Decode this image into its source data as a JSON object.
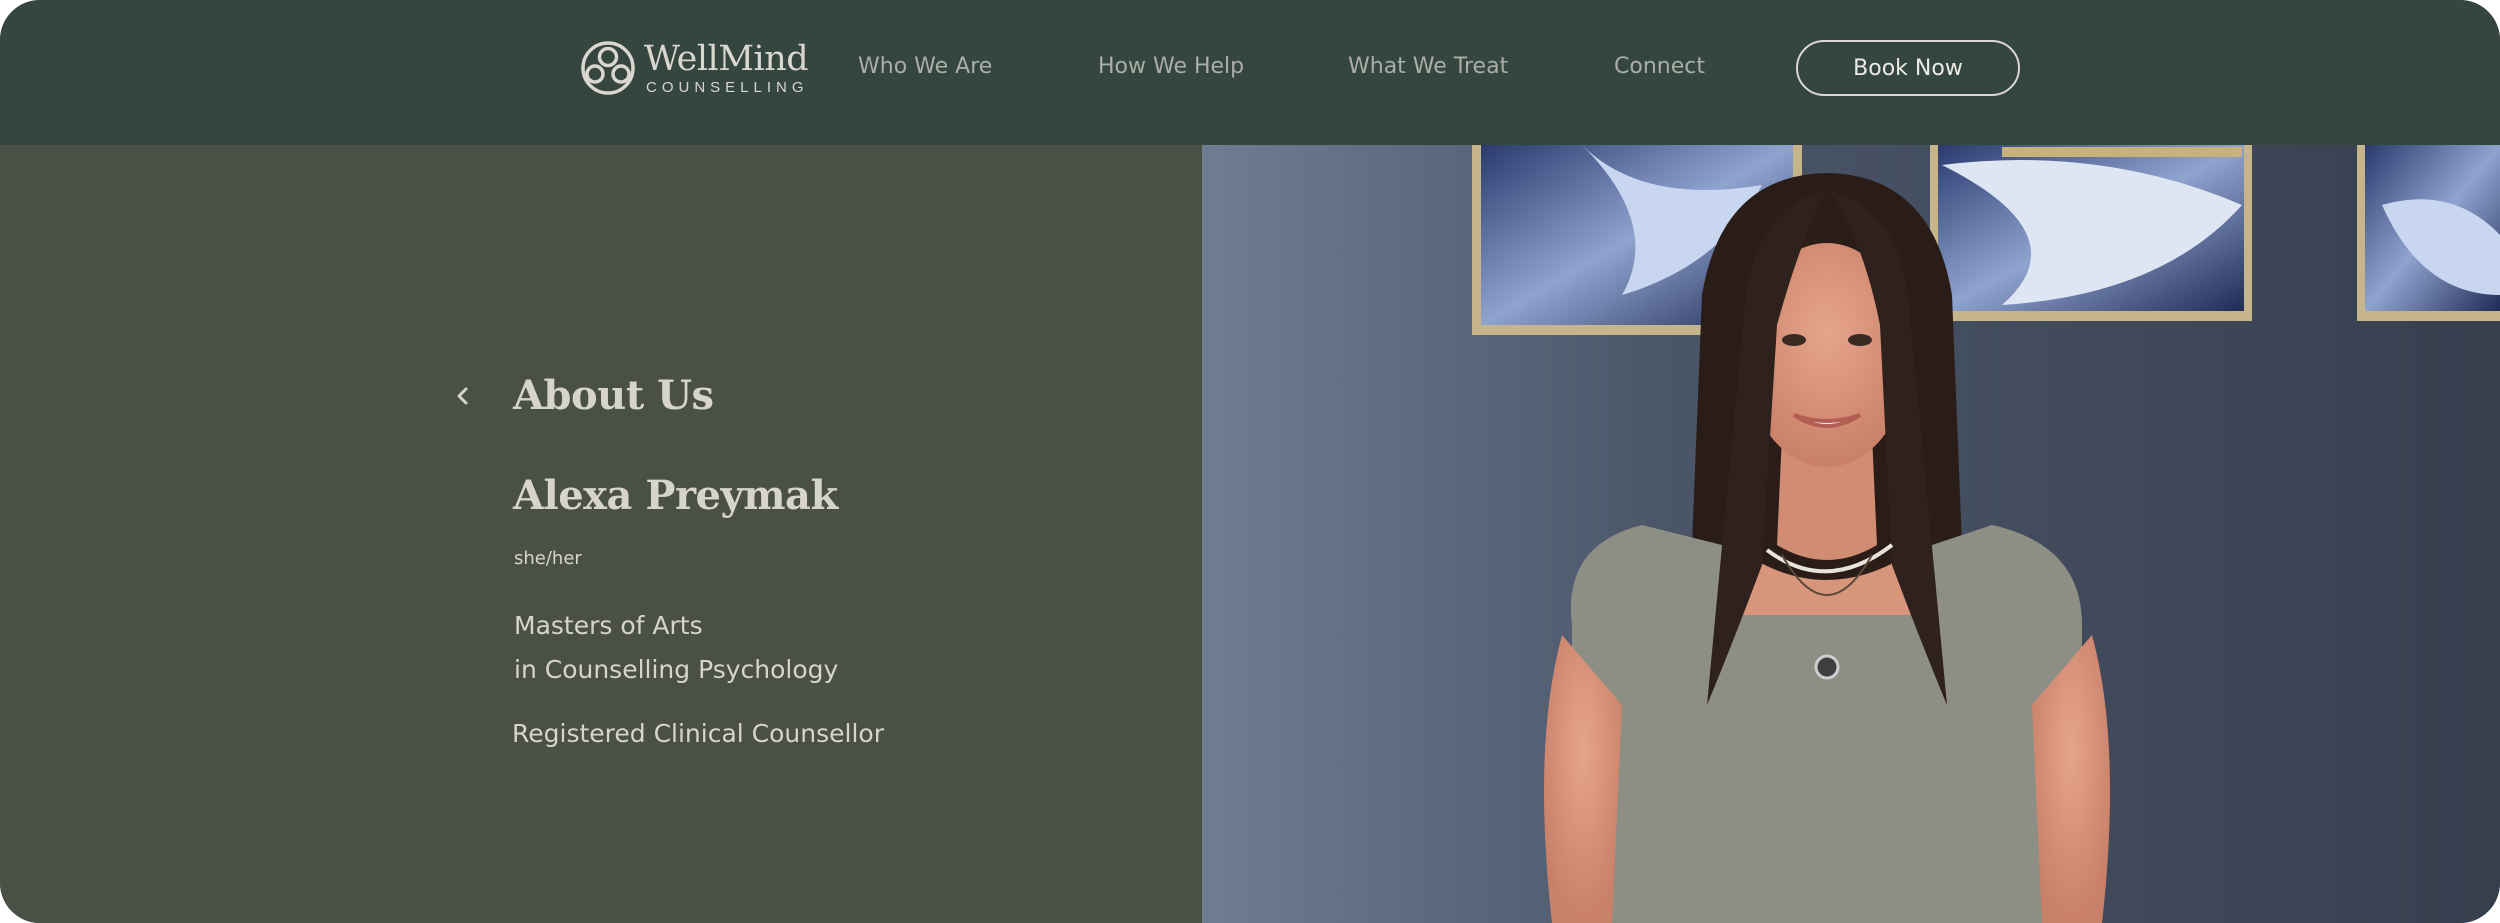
{
  "brand": {
    "name": "WellMind",
    "subtitle": "COUNSELLING",
    "logo_icon": "wellmind-logo-icon"
  },
  "nav": {
    "links": [
      "Who We Are",
      "How We Help",
      "What We Treat",
      "Connect"
    ],
    "cta_label": "Book Now"
  },
  "profile": {
    "section_title": "About Us",
    "back_icon": "chevron-left-icon",
    "name": "Alexa Preymak",
    "pronouns": "she/her",
    "degree_line1": "Masters of Arts",
    "degree_line2": "in Counselling Psychology",
    "designation": "Registered Clinical Counsellor"
  },
  "colors": {
    "nav_background": "#354540",
    "panel_background": "#4a5046",
    "text_light": "#d6d4cc",
    "nav_text": "#a9aea6"
  }
}
